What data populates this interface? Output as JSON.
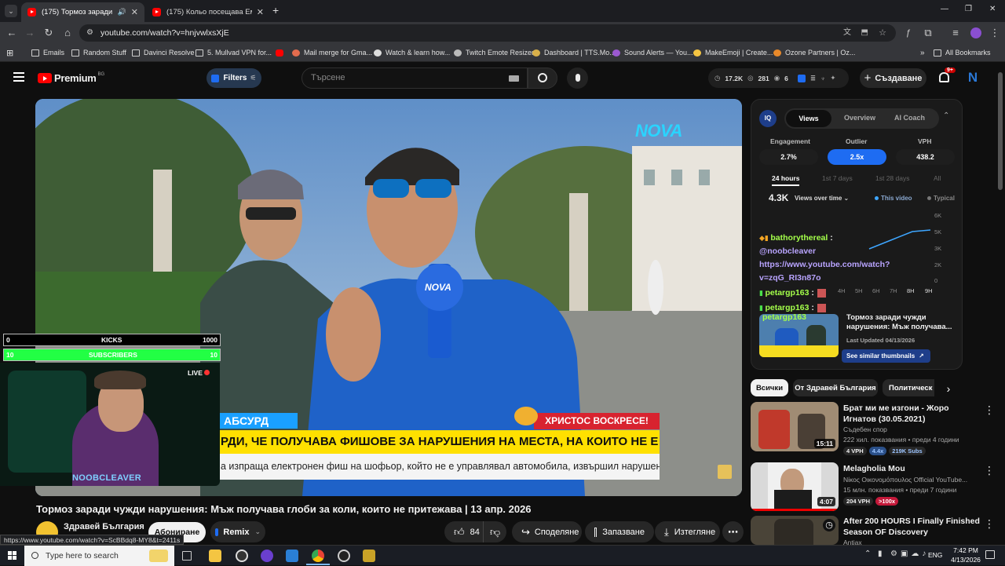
{
  "browser": {
    "tabs": [
      {
        "title": "(175) Тормоз заради чужд",
        "active": true
      },
      {
        "title": "(175) Кольо посещава Емо в т",
        "active": false
      }
    ],
    "new_tab": "+",
    "url": "youtube.com/watch?v=hnjvwlxsXjE",
    "window_controls": [
      "—",
      "❐",
      "✕"
    ],
    "bookmarks": [
      "Emails",
      "Random Stuff",
      "Davinci Resolve",
      "5. Mullvad VPN for...",
      "Mail merge for Gma...",
      "Watch & learn how...",
      "Twitch Emote Resizer",
      "Dashboard | TTS.Mo...",
      "Sound Alerts — You...",
      "MakeEmoji | Create...",
      "Ozone Partners | Oz..."
    ],
    "all_bookmarks": "All Bookmarks"
  },
  "yt": {
    "logo": "Premium",
    "logo_sup": "BG",
    "filters": "Filters",
    "search_placeholder": "Търсене",
    "stats": {
      "views": "17.2K",
      "likes": "281",
      "eye": "6"
    },
    "create": "Създаване",
    "notif_count": "9+",
    "avatar": "N"
  },
  "video": {
    "title": "Тормоз заради чужди нарушения: Мъж получава глоби за коли, които не притежава | 13 апр. 2026",
    "channel": "Здравей България",
    "subscribe": "Абониране",
    "remix": "Remix",
    "likes": "84",
    "share": "Споделяне",
    "save": "Запазване",
    "download": "Изтегляне",
    "overlay": {
      "brand": "NOVA",
      "mic_brand": "NOVA",
      "tag": "АБСУРД",
      "easter": "ХРИСТОС ВОСКРЕСЕ!",
      "headline": "РДИ, ЧЕ ПОЛУЧАВА ФИШОВЕ ЗА НАРУШЕНИЯ НА МЕСТА, НА КОИТО НЕ Е БИЛ",
      "subline": "а изпраща електронен фиш на шофьор, който не е управлявал автомобила, извършил нарушението?"
    },
    "stream": {
      "kicks_label": "KICKS",
      "kicks_left": "0",
      "kicks_right": "1000",
      "subs_label": "SUBSCRIBERS",
      "subs_left": "10",
      "subs_right": "10",
      "live": "LIVE",
      "streamer": "NOOBCLEAVER"
    }
  },
  "vidiq": {
    "badge": "IQ",
    "tabs": [
      "Views",
      "Overview",
      "AI Coach"
    ],
    "metrics": [
      {
        "label": "Engagement",
        "value": "2.7%"
      },
      {
        "label": "Outlier",
        "value": "2.5x"
      },
      {
        "label": "VPH",
        "value": "438.2"
      }
    ],
    "ranges": [
      "24 hours",
      "1st 7 days",
      "1st 28 days",
      "All"
    ],
    "total": "4.3K",
    "views_over": "Views over time",
    "legend_this": "This video",
    "legend_typical": "Typical",
    "yticks": [
      "6K",
      "5K",
      "3K",
      "2K",
      "0"
    ],
    "xticks": [
      "4H",
      "5H",
      "6H",
      "7H",
      "8H",
      "9H"
    ],
    "chat": [
      {
        "user": "bathorythereal",
        "sep": ":"
      },
      {
        "text": "@noobcleaver"
      },
      {
        "text": "https://www.youtube.com/watch?"
      },
      {
        "text": "v=zqG_RI3n87o"
      },
      {
        "user": "petargp163",
        "sep": ":"
      },
      {
        "user": "petargp163",
        "sep": ":"
      },
      {
        "user": "petargp163",
        "sep": ""
      }
    ],
    "thumb_title": "Тормоз заради чужди нарушения: Мъж получава...",
    "last_updated": "Last Updated 04/13/2026",
    "similar": "See similar thumbnails"
  },
  "chips": [
    "Всички",
    "От Здравей България",
    "Политическ"
  ],
  "recs": [
    {
      "title": "Брат ми ме изгони - Жоро Игнатов (30.05.2021)",
      "channel": "Съдебен спор",
      "meta": "222 хил. показвания • преди 4 години",
      "dur": "15:11",
      "badges": [
        "4 VPH",
        "4.4x",
        "219K Subs"
      ]
    },
    {
      "title": "Melagholia Mou",
      "channel": "Νίκος Οικονομόπουλος Official YouTube...",
      "meta": "15 млн. показвания • преди 7 години",
      "dur": "4:07",
      "badges": [
        "204 VPH",
        ">100x"
      ]
    },
    {
      "title": "After 200 HOURS I Finally Finished Season OF Discovery",
      "channel": "Antiax",
      "meta": "",
      "dur": "",
      "badges": []
    }
  ],
  "status_url": "https://www.youtube.com/watch?v=ScBBdq8-MY8&t=2411s",
  "taskbar": {
    "search": "Type here to search",
    "lang": "ENG",
    "time": "7:42 PM",
    "date": "4/13/2026"
  },
  "colors": {
    "accent_blue": "#3ea6ff",
    "vidiq_blue": "#1e6cf2",
    "yt_red": "#ff0000",
    "green_bar": "#22ff44"
  }
}
